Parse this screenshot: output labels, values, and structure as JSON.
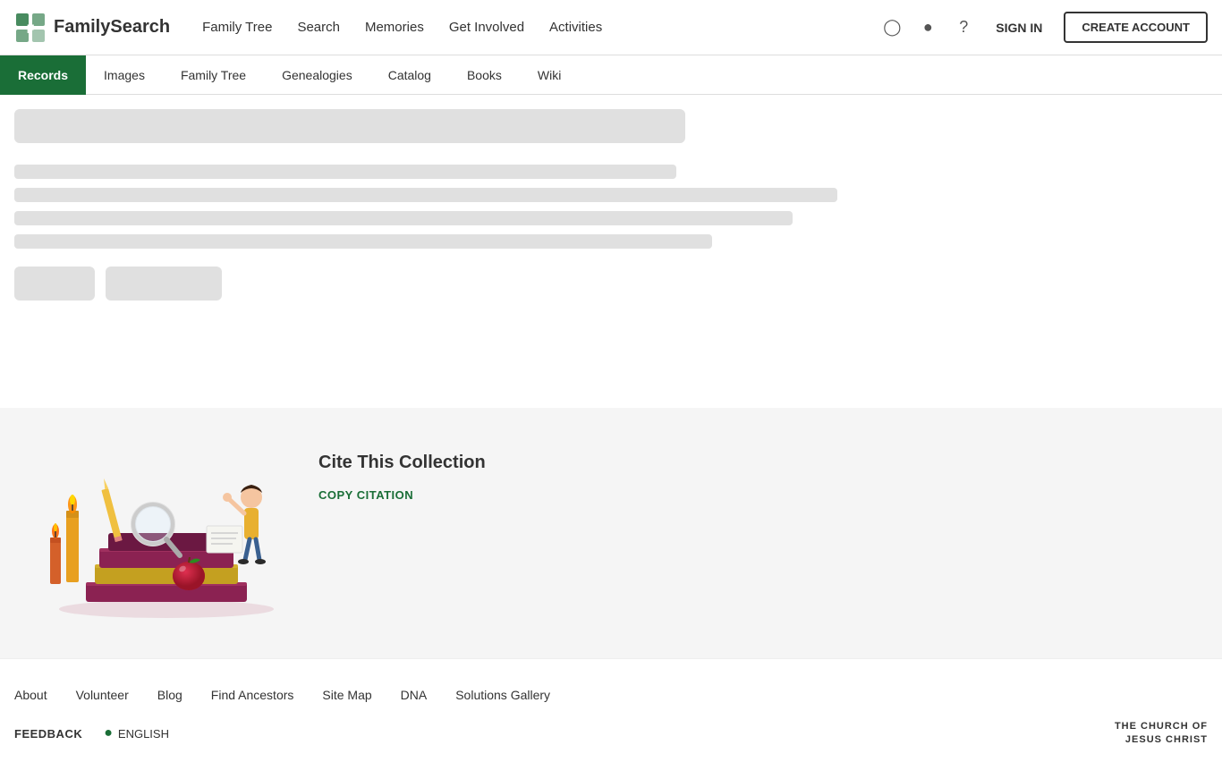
{
  "header": {
    "logo_text": "FamilySearch",
    "nav": [
      {
        "label": "Family Tree",
        "href": "#"
      },
      {
        "label": "Search",
        "href": "#"
      },
      {
        "label": "Memories",
        "href": "#"
      },
      {
        "label": "Get Involved",
        "href": "#"
      },
      {
        "label": "Activities",
        "href": "#"
      }
    ],
    "sign_in_label": "SIGN IN",
    "create_account_label": "CREATE ACCOUNT"
  },
  "sub_nav": {
    "items": [
      {
        "label": "Records",
        "active": true
      },
      {
        "label": "Images",
        "active": false
      },
      {
        "label": "Family Tree",
        "active": false
      },
      {
        "label": "Genealogies",
        "active": false
      },
      {
        "label": "Catalog",
        "active": false
      },
      {
        "label": "Books",
        "active": false
      },
      {
        "label": "Wiki",
        "active": false
      }
    ]
  },
  "cite_section": {
    "title": "Cite This Collection",
    "copy_citation_label": "COPY CITATION"
  },
  "footer": {
    "links": [
      {
        "label": "About"
      },
      {
        "label": "Volunteer"
      },
      {
        "label": "Blog"
      },
      {
        "label": "Find Ancestors"
      },
      {
        "label": "Site Map"
      },
      {
        "label": "DNA"
      },
      {
        "label": "Solutions Gallery"
      }
    ],
    "feedback_label": "FEEDBACK",
    "language_label": "ENGLISH",
    "church_line1": "THE CHURCH OF",
    "church_line2": "JESUS CHRIST"
  }
}
